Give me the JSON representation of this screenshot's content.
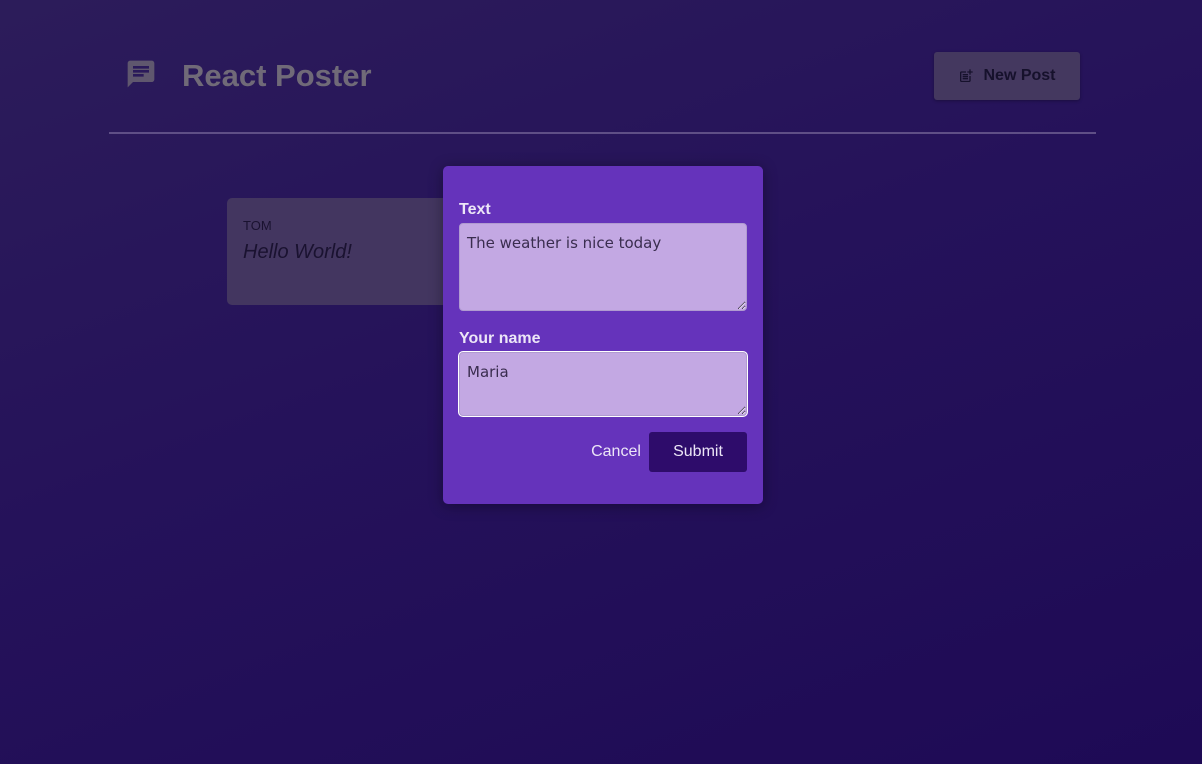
{
  "header": {
    "logo_icon": "chat-message-icon",
    "title": "React Poster",
    "new_post_button": {
      "label": "New Post",
      "icon": "post-add-icon"
    }
  },
  "posts": [
    {
      "author": "TOM",
      "text": "Hello World!"
    }
  ],
  "modal": {
    "text_label": "Text",
    "text_value": "The weather is nice today",
    "name_label": "Your name",
    "name_value": "Maria",
    "cancel_label": "Cancel",
    "submit_label": "Submit"
  },
  "colors": {
    "background": "#25125a",
    "modal_background": "#6533bb",
    "field_background": "#c3a8e3",
    "submit_background": "#2e0c6b",
    "card_background": "#433660"
  }
}
